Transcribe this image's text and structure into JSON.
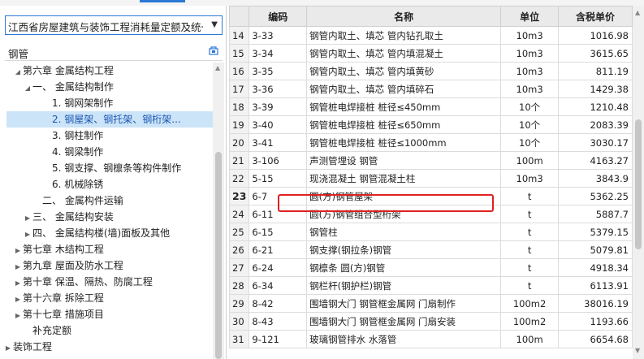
{
  "quota_library": "江西省房屋建筑与装饰工程消耗量定额及统一基价表",
  "search_value": "钢管",
  "icons": {
    "dropdown": "chevron-down-icon",
    "search": "search-filter-icon"
  },
  "accent_color": "#2b78d6",
  "highlight_color": "#e02020",
  "tree": [
    {
      "label": "第六章 金属结构工程",
      "indent": 2,
      "toggle": "▲"
    },
    {
      "label": "一、 金属结构制作",
      "indent": 3,
      "toggle": "▲"
    },
    {
      "label": "1. 钢网架制作",
      "indent": 5,
      "toggle": ""
    },
    {
      "label": "2. 钢屋架、钢托架、钢桁架...",
      "indent": 5,
      "toggle": "",
      "selected": true
    },
    {
      "label": "3. 钢柱制作",
      "indent": 5,
      "toggle": ""
    },
    {
      "label": "4. 钢梁制作",
      "indent": 5,
      "toggle": ""
    },
    {
      "label": "5. 钢支撑、钢檩条等构件制作",
      "indent": 5,
      "toggle": ""
    },
    {
      "label": "6. 机械除锈",
      "indent": 5,
      "toggle": ""
    },
    {
      "label": "二、 金属构件运输",
      "indent": 4,
      "toggle": ""
    },
    {
      "label": "三、 金属结构安装",
      "indent": 3,
      "toggle": "▶"
    },
    {
      "label": "四、 金属结构楼(墙)面板及其他",
      "indent": 3,
      "toggle": "▶"
    },
    {
      "label": "第七章 木结构工程",
      "indent": 2,
      "toggle": "▶"
    },
    {
      "label": "第九章 屋面及防水工程",
      "indent": 2,
      "toggle": "▶"
    },
    {
      "label": "第十章 保温、隔热、防腐工程",
      "indent": 2,
      "toggle": "▶"
    },
    {
      "label": "第十六章 拆除工程",
      "indent": 2,
      "toggle": "▶"
    },
    {
      "label": "第十七章 措施项目",
      "indent": 2,
      "toggle": "▶"
    },
    {
      "label": "补充定额",
      "indent": 3,
      "toggle": ""
    },
    {
      "label": "装饰工程",
      "indent": 1,
      "toggle": "▶"
    }
  ],
  "columns": {
    "code": "编码",
    "name": "名称",
    "unit": "单位",
    "price": "含税单价"
  },
  "rows": [
    {
      "idx": "14",
      "code": "3-33",
      "name": "钢管内取土、填芯 管内钻孔取土",
      "unit": "10m3",
      "price": "1016.98"
    },
    {
      "idx": "15",
      "code": "3-34",
      "name": "钢管内取土、填芯 管内填混凝土",
      "unit": "10m3",
      "price": "3615.65"
    },
    {
      "idx": "16",
      "code": "3-35",
      "name": "钢管内取土、填芯 管内填黄砂",
      "unit": "10m3",
      "price": "811.19"
    },
    {
      "idx": "17",
      "code": "3-36",
      "name": "钢管内取土、填芯 管内填碎石",
      "unit": "10m3",
      "price": "1429.38"
    },
    {
      "idx": "18",
      "code": "3-39",
      "name": "钢管桩电焊接桩 桩径≤450mm",
      "unit": "10个",
      "price": "1210.48"
    },
    {
      "idx": "19",
      "code": "3-40",
      "name": "钢管桩电焊接桩 桩径≤650mm",
      "unit": "10个",
      "price": "2083.39"
    },
    {
      "idx": "20",
      "code": "3-41",
      "name": "钢管桩电焊接桩 桩径≤1000mm",
      "unit": "10个",
      "price": "3030.17"
    },
    {
      "idx": "21",
      "code": "3-106",
      "name": "声测管埋设 钢管",
      "unit": "100m",
      "price": "4163.27"
    },
    {
      "idx": "22",
      "code": "5-15",
      "name": "现浇混凝土 钢管混凝土柱",
      "unit": "10m3",
      "price": "3843.9"
    },
    {
      "idx": "23",
      "code": "6-7",
      "name": "圆(方)钢管屋架",
      "unit": "t",
      "price": "5362.25",
      "current": true
    },
    {
      "idx": "24",
      "code": "6-11",
      "name": "圆(方)钢管组合型桁架",
      "unit": "t",
      "price": "5887.7"
    },
    {
      "idx": "25",
      "code": "6-15",
      "name": "钢管柱",
      "unit": "t",
      "price": "5379.15"
    },
    {
      "idx": "26",
      "code": "6-21",
      "name": "钢支撑(钢拉条)钢管",
      "unit": "t",
      "price": "5079.81"
    },
    {
      "idx": "27",
      "code": "6-24",
      "name": "钢檩条 圆(方)钢管",
      "unit": "t",
      "price": "4918.34"
    },
    {
      "idx": "28",
      "code": "6-34",
      "name": "钢栏杆(钢护栏)钢管",
      "unit": "t",
      "price": "6113.91"
    },
    {
      "idx": "29",
      "code": "8-42",
      "name": "围墙钢大门 钢管框金属网 门扇制作",
      "unit": "100m2",
      "price": "38016.19"
    },
    {
      "idx": "30",
      "code": "8-43",
      "name": "围墙钢大门 钢管框金属网 门扇安装",
      "unit": "100m2",
      "price": "1193.66"
    },
    {
      "idx": "31",
      "code": "9-121",
      "name": "玻璃钢管排水 水落管",
      "unit": "100m",
      "price": "6654.68"
    }
  ]
}
